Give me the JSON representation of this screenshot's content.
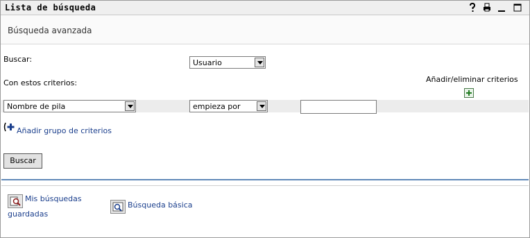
{
  "window": {
    "title": "Lista de búsqueda"
  },
  "titlebar_icons": [
    "help-icon",
    "print-icon",
    "minimize-icon",
    "maximize-icon"
  ],
  "subheader": {
    "title": "Búsqueda avanzada"
  },
  "search": {
    "buscar_label": "Buscar:",
    "object_type": "Usuario",
    "criteria_label": "Con estos criterios:",
    "add_remove_label": "Añadir/eliminar criterios",
    "attribute": "Nombre de pila",
    "operator": "empieza por",
    "value": "",
    "add_group_label": "Añadir grupo de criterios",
    "submit_label": "Buscar"
  },
  "footer": {
    "saved_searches_line1": "Mis búsquedas",
    "saved_searches_line2": "guardadas",
    "basic_search": "Búsqueda básica"
  },
  "colors": {
    "link": "#1a3e8c",
    "rule": "#5f88b8",
    "band": "#ececec"
  }
}
